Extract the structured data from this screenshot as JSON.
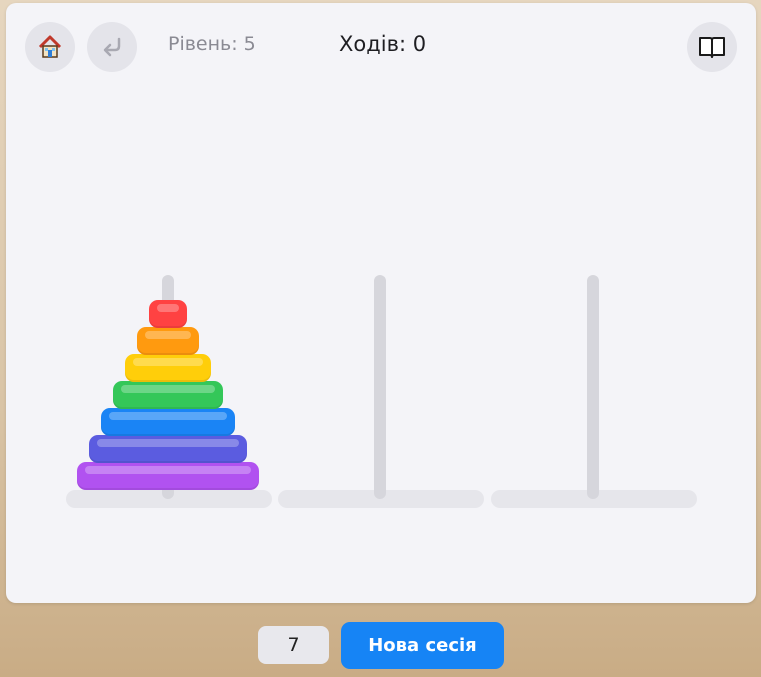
{
  "header": {
    "level_text": "Рівень: 5",
    "moves_text": "Ходів: 0"
  },
  "icons": {
    "home": "house-icon",
    "undo": "undo-arrow-icon",
    "book": "open-book-icon"
  },
  "game": {
    "type": "tower-of-hanoi",
    "rods": 3,
    "disks_on_rod": [
      [
        7,
        6,
        5,
        4,
        3,
        2,
        1
      ],
      [],
      []
    ],
    "disk_colors": [
      "#ff4242",
      "#ff9a0f",
      "#ffce0a",
      "#34c759",
      "#1a84f5",
      "#5b5ce0",
      "#b152f0"
    ]
  },
  "footer": {
    "disk_count_value": "7",
    "new_session_label": "Нова сесія"
  }
}
